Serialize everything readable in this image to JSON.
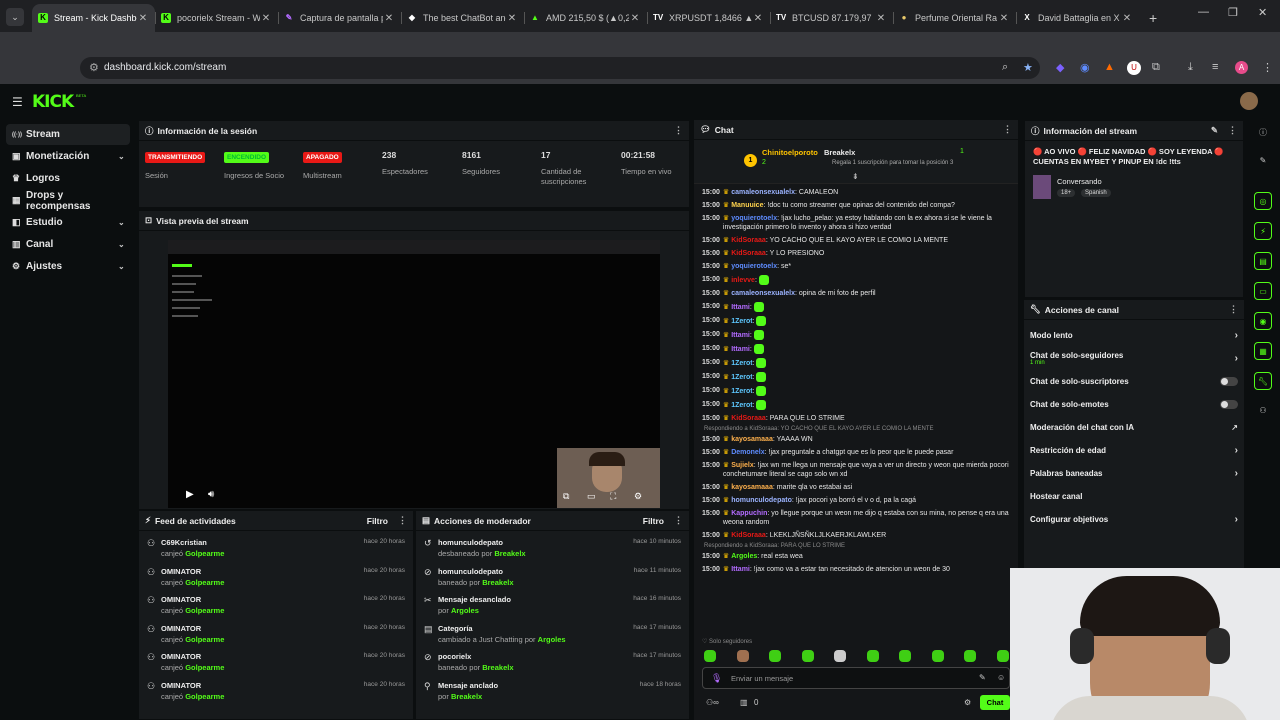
{
  "browser": {
    "tabs": [
      {
        "label": "Stream - Kick Dashbo",
        "icon": "kick-icon",
        "active": true
      },
      {
        "label": "pocorielx Stream - W",
        "icon": "kick-icon"
      },
      {
        "label": "Captura de pantalla p",
        "icon": "feather-icon"
      },
      {
        "label": "The best ChatBot and",
        "icon": "chatbot-icon"
      },
      {
        "label": "AMD 215,50 $ (▲0,2",
        "icon": "chart-icon"
      },
      {
        "label": "XRPUSDT 1,8466 ▲",
        "icon": "tv-icon"
      },
      {
        "label": "BTCUSD 87.179,97 ▲",
        "icon": "tv-icon"
      },
      {
        "label": "Perfume Oriental Ra",
        "icon": "perfume-icon"
      },
      {
        "label": "David Battaglia en X",
        "icon": "x-icon"
      }
    ],
    "url": "dashboard.kick.com/stream"
  },
  "brand": {
    "logo": "KICK",
    "beta": "BETA",
    "accent": "#53fc18"
  },
  "sidebar": {
    "items": [
      {
        "label": "Stream",
        "icon": "stream-icon",
        "active": true,
        "chevron": false
      },
      {
        "label": "Monetización",
        "icon": "money-icon",
        "chevron": true
      },
      {
        "label": "Logros",
        "icon": "trophy-icon",
        "chevron": false
      },
      {
        "label": "Drops y recompensas",
        "icon": "gift-icon",
        "chevron": false
      },
      {
        "label": "Estudio",
        "icon": "studio-icon",
        "chevron": true
      },
      {
        "label": "Canal",
        "icon": "channel-icon",
        "chevron": true
      },
      {
        "label": "Ajustes",
        "icon": "gear-icon",
        "chevron": true
      }
    ]
  },
  "session": {
    "title": "Información de la sesión",
    "stats": [
      {
        "badge": "TRANSMITIENDO",
        "badge_color": "#e91916",
        "label": "Sesión"
      },
      {
        "badge": "ENCENDIDO",
        "badge_color": "#53fc18",
        "label": "Ingresos de Socio"
      },
      {
        "badge": "APAGADO",
        "badge_color": "#e91916",
        "label": "Multistream"
      },
      {
        "value": "238",
        "label": "Espectadores"
      },
      {
        "value": "8161",
        "label": "Seguidores"
      },
      {
        "value": "17",
        "label": "Cantidad de suscripciones"
      },
      {
        "value": "00:21:58",
        "label": "Tiempo en vivo"
      }
    ]
  },
  "preview": {
    "title": "Vista previa del stream"
  },
  "feed": {
    "title": "Feed de actividades",
    "filter": "Filtro",
    "items": [
      {
        "name": "C69Kcristian",
        "action": "canjeó",
        "target": "Golpearme",
        "time": "hace 20 horas"
      },
      {
        "name": "OMINATOR",
        "action": "canjeó",
        "target": "Golpearme",
        "time": "hace 20 horas"
      },
      {
        "name": "OMINATOR",
        "action": "canjeó",
        "target": "Golpearme",
        "time": "hace 20 horas"
      },
      {
        "name": "OMINATOR",
        "action": "canjeó",
        "target": "Golpearme",
        "time": "hace 20 horas"
      },
      {
        "name": "OMINATOR",
        "action": "canjeó",
        "target": "Golpearme",
        "time": "hace 20 horas"
      },
      {
        "name": "OMINATOR",
        "action": "canjeó",
        "target": "Golpearme",
        "time": "hace 20 horas"
      }
    ]
  },
  "mod": {
    "title": "Acciones de moderador",
    "filter": "Filtro",
    "items": [
      {
        "name": "homunculodepato",
        "action": "desbaneado por",
        "target": "Breakelx",
        "time": "hace 10 minutos",
        "icon": "undo-icon"
      },
      {
        "name": "homunculodepato",
        "action": "baneado por",
        "target": "Breakelx",
        "time": "hace 11 minutos",
        "icon": "ban-icon"
      },
      {
        "name": "Mensaje desanclado",
        "action": "por",
        "target": "Argoles",
        "time": "hace 16 minutos",
        "icon": "unpin-icon"
      },
      {
        "name": "Categoría",
        "action": "cambiado a Just Chatting por",
        "target": "Argoles",
        "time": "hace 17 minutos",
        "icon": "category-icon"
      },
      {
        "name": "pocorielx",
        "action": "baneado por",
        "target": "Breakelx",
        "time": "hace 17 minutos",
        "icon": "ban-icon"
      },
      {
        "name": "Mensaje anclado",
        "action": "por",
        "target": "Breakelx",
        "time": "hace 18 horas",
        "icon": "pin-icon"
      }
    ]
  },
  "chat": {
    "title": "Chat",
    "gift": {
      "user": "Chinitoelporoto",
      "count": "2",
      "to": "Breakelx",
      "level": "1",
      "note": "Regala 1 suscripción para tomar la posición 3"
    },
    "messages": [
      {
        "time": "15:00",
        "user": "camaleonsexualelx",
        "color": "#9bb3ff",
        "text": "CAMALEON"
      },
      {
        "time": "15:00",
        "user": "Manuuice",
        "color": "#ffd34d",
        "text": "!doc tu como streamer que opinas del contenido del compa?"
      },
      {
        "time": "15:00",
        "user": "yoquierotoelx",
        "color": "#5e8cff",
        "text": "!jax lucho_pelao: ya estoy hablando con la ex ahora si se le viene la investigación primero lo invento y ahora si hizo verdad"
      },
      {
        "time": "15:00",
        "user": "KidSoraaa",
        "color": "#e91916",
        "text": "YO CACHO QUE EL KAYO AYER LE COMIO LA MENTE"
      },
      {
        "time": "15:00",
        "user": "KidSoraaa",
        "color": "#e91916",
        "text": "Y LO PRESIONO"
      },
      {
        "time": "15:00",
        "user": "yoquierotoelx",
        "color": "#5e8cff",
        "text": "se*"
      },
      {
        "time": "15:00",
        "user": "inlevve",
        "color": "#e91916",
        "text": "",
        "emote": true
      },
      {
        "time": "15:00",
        "user": "camaleonsexualelx",
        "color": "#9bb3ff",
        "text": "opina de mi foto de perfil"
      },
      {
        "time": "15:00",
        "user": "Ittami",
        "color": "#b36bff",
        "text": "",
        "emote": true
      },
      {
        "time": "15:00",
        "user": "1Zerot",
        "color": "#5ec8ff",
        "text": "",
        "emote": true
      },
      {
        "time": "15:00",
        "user": "Ittami",
        "color": "#b36bff",
        "text": "",
        "emote": true
      },
      {
        "time": "15:00",
        "user": "Ittami",
        "color": "#b36bff",
        "text": "",
        "emote": true
      },
      {
        "time": "15:00",
        "user": "1Zerot",
        "color": "#5ec8ff",
        "text": "",
        "emote": true
      },
      {
        "time": "15:00",
        "user": "1Zerot",
        "color": "#5ec8ff",
        "text": "",
        "emote": true
      },
      {
        "time": "15:00",
        "user": "1Zerot",
        "color": "#5ec8ff",
        "text": "",
        "emote": true
      },
      {
        "time": "15:00",
        "user": "1Zerot",
        "color": "#5ec8ff",
        "text": "",
        "emote": true
      },
      {
        "time": "15:00",
        "user": "KidSoraaa",
        "color": "#e91916",
        "text": "PARA QUE LO STRIME"
      },
      {
        "reply": "Respondiendo a KidSoraaa: YO CACHO QUE EL KAYO AYER LE COMIO LA MENTE"
      },
      {
        "time": "15:00",
        "user": "kayosamaaa",
        "color": "#ffb14d",
        "text": "YAAAA WN"
      },
      {
        "time": "15:00",
        "user": "Demonelx",
        "color": "#5e8cff",
        "text": "!jax preguntale a chatgpt que es lo peor que le puede pasar"
      },
      {
        "time": "15:00",
        "user": "Sujielx",
        "color": "#ffb14d",
        "text": "!jax wn me llega un mensaje que vaya a ver un directo y weon que mierda pocori conchetumare literal se cago solo wn xd"
      },
      {
        "time": "15:00",
        "user": "kayosamaaa",
        "color": "#ffb14d",
        "text": "marite qla vo estabai asi"
      },
      {
        "time": "15:00",
        "user": "homunculodepato",
        "color": "#9bb3ff",
        "text": "!jax pocori ya borró el v o d, pa la cagá"
      },
      {
        "time": "15:00",
        "user": "Kappuchin",
        "color": "#b36bff",
        "text": "yo llegue porque un weon me dijo q estaba con su mina, no pense q era una weona random"
      },
      {
        "time": "15:00",
        "user": "KidSoraaa",
        "color": "#e91916",
        "text": "LKEKLJÑSÑKLJLKAERJKLAWLKER"
      },
      {
        "reply": "Respondiendo a KidSoraaa: PARA QUE LO STRIME"
      },
      {
        "time": "15:00",
        "user": "Argoles",
        "color": "#53fc18",
        "text": "real esta wea"
      },
      {
        "time": "15:00",
        "user": "Ittami",
        "color": "#b36bff",
        "text": "!jax como va a estar tan necesitado de atencion un weon de 30"
      }
    ],
    "followers_only": "Solo seguidores",
    "input_placeholder": "Enviar un mensaje",
    "users_count": "0",
    "send_label": "Chat"
  },
  "stream_info": {
    "title": "Información del stream",
    "stream_title": "🔴 AO VIVO 🔴 FELIZ NAVIDAD 🔴 SOY LEYENDA 🔴 CUENTAS EN MYBET Y PINUP EN !dc !tts",
    "category": "Conversando",
    "tags": [
      "18+",
      "Spanish"
    ]
  },
  "channel_actions": {
    "title": "Acciones de canal",
    "items": [
      {
        "label": "Modo lento",
        "kind": "chevron"
      },
      {
        "label": "Chat de solo-seguidores",
        "sub": "1 min",
        "kind": "chevron"
      },
      {
        "label": "Chat de solo-suscriptores",
        "kind": "toggle"
      },
      {
        "label": "Chat de solo-emotes",
        "kind": "toggle"
      },
      {
        "label": "Moderación del chat con IA",
        "kind": "external"
      },
      {
        "label": "Restricción de edad",
        "kind": "chevron"
      },
      {
        "label": "Palabras baneadas",
        "kind": "chevron"
      },
      {
        "label": "Hostear canal",
        "kind": "none"
      },
      {
        "label": "Configurar objetivos",
        "kind": "chevron"
      }
    ]
  }
}
